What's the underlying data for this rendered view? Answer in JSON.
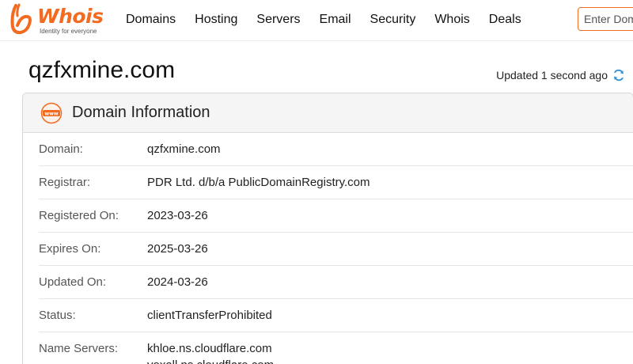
{
  "header": {
    "logo_text": "Whois",
    "logo_tagline": "Identity for everyone",
    "nav": [
      "Domains",
      "Hosting",
      "Servers",
      "Email",
      "Security",
      "Whois",
      "Deals"
    ],
    "search_placeholder": "Enter Domain",
    "brand_color": "#f26b21"
  },
  "page": {
    "title": "qzfxmine.com",
    "updated_text": "Updated 1 second ago"
  },
  "card": {
    "title": "Domain Information",
    "icon_label": "www",
    "rows": [
      {
        "label": "Domain:",
        "value": "qzfxmine.com"
      },
      {
        "label": "Registrar:",
        "value": "PDR Ltd. d/b/a PublicDomainRegistry.com"
      },
      {
        "label": "Registered On:",
        "value": "2023-03-26"
      },
      {
        "label": "Expires On:",
        "value": "2025-03-26"
      },
      {
        "label": "Updated On:",
        "value": "2024-03-26"
      },
      {
        "label": "Status:",
        "value": "clientTransferProhibited"
      }
    ],
    "name_servers": {
      "label": "Name Servers:",
      "values": [
        "khloe.ns.cloudflare.com",
        "yoxall.ns.cloudflare.com"
      ]
    }
  },
  "icons": {
    "logo": "whois-logo-icon",
    "refresh": "refresh-icon",
    "www": "www-icon"
  }
}
